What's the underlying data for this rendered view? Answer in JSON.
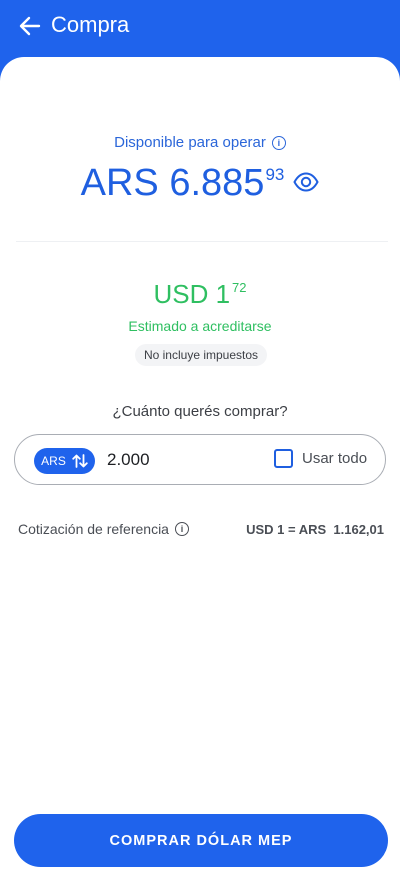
{
  "header": {
    "title": "Compra"
  },
  "balance": {
    "label": "Disponible para operar",
    "amount": "ARS 6.885",
    "cents": "93"
  },
  "estimate": {
    "amount": "USD 1",
    "cents": "72",
    "label": "Estimado a acreditarse",
    "tax_note": "No incluye impuestos"
  },
  "purchase": {
    "question": "¿Cuánto querés comprar?",
    "currency": "ARS",
    "amount_value": "2.000",
    "use_all_label": "Usar todo",
    "use_all_checked": false
  },
  "reference": {
    "label": "Cotización de referencia",
    "value": "USD 1 = ARS  1.162,01"
  },
  "cta": {
    "label": "COMPRAR DÓLAR MEP"
  },
  "colors": {
    "brand": "#1f63ec",
    "positive": "#2fbf61"
  },
  "icons": [
    "arrow-left-icon",
    "info-icon",
    "eye-icon",
    "swap-vertical-icon",
    "checkbox-icon"
  ]
}
